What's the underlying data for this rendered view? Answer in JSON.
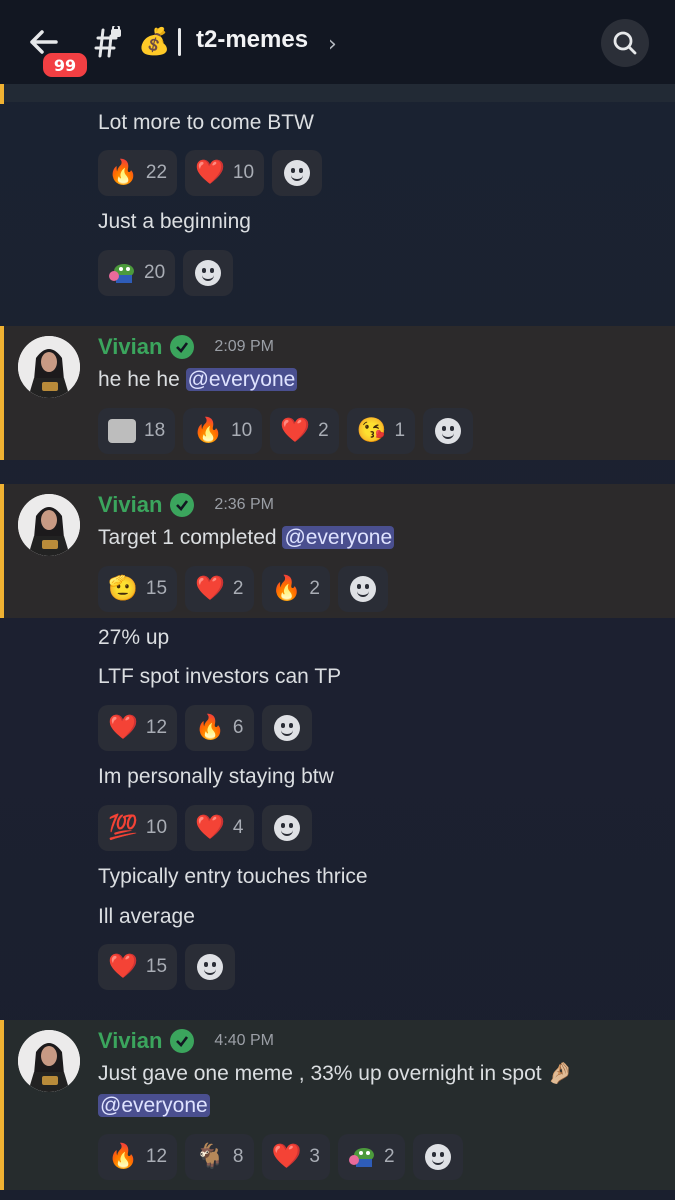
{
  "header": {
    "badge": "99",
    "channel": "t2-memes",
    "chevron": "›",
    "emoji": "💰"
  },
  "messages": [
    {
      "text": "Lot more to come BTW",
      "reactions": [
        {
          "emoji": "🔥",
          "count": "22"
        },
        {
          "emoji": "❤️",
          "count": "10"
        }
      ]
    },
    {
      "text": "Just a beginning",
      "reactions": [
        {
          "emoji": "pepe",
          "count": "20"
        }
      ]
    },
    {
      "author": "Vivian",
      "time": "2:09 PM",
      "text": "he he he ",
      "mention": "@everyone",
      "reactions": [
        {
          "emoji": "face",
          "count": "18"
        },
        {
          "emoji": "🔥",
          "count": "10"
        },
        {
          "emoji": "❤️",
          "count": "2"
        },
        {
          "emoji": "😘",
          "count": "1"
        }
      ]
    },
    {
      "author": "Vivian",
      "time": "2:36 PM",
      "text": "Target 1 completed ",
      "mention": "@everyone",
      "reactions": [
        {
          "emoji": "🫡",
          "count": "15"
        },
        {
          "emoji": "❤️",
          "count": "2"
        },
        {
          "emoji": "🔥",
          "count": "2"
        }
      ]
    },
    {
      "text": "27% up"
    },
    {
      "text": "LTF spot investors can TP",
      "reactions": [
        {
          "emoji": "❤️",
          "count": "12"
        },
        {
          "emoji": "🔥",
          "count": "6"
        }
      ]
    },
    {
      "text": "Im personally staying btw",
      "reactions": [
        {
          "emoji": "💯",
          "count": "10"
        },
        {
          "emoji": "❤️",
          "count": "4"
        }
      ]
    },
    {
      "text": "Typically entry touches thrice"
    },
    {
      "text": "Ill average",
      "reactions": [
        {
          "emoji": "❤️",
          "count": "15"
        }
      ]
    },
    {
      "author": "Vivian",
      "time": "4:40 PM",
      "text": "Just gave one meme , 33% up overnight in spot 🤌🏼",
      "mention": "@everyone",
      "reactions": [
        {
          "emoji": "🔥",
          "count": "12"
        },
        {
          "emoji": "🐐",
          "count": "8"
        },
        {
          "emoji": "❤️",
          "count": "3"
        },
        {
          "emoji": "pepe",
          "count": "2"
        }
      ]
    }
  ]
}
